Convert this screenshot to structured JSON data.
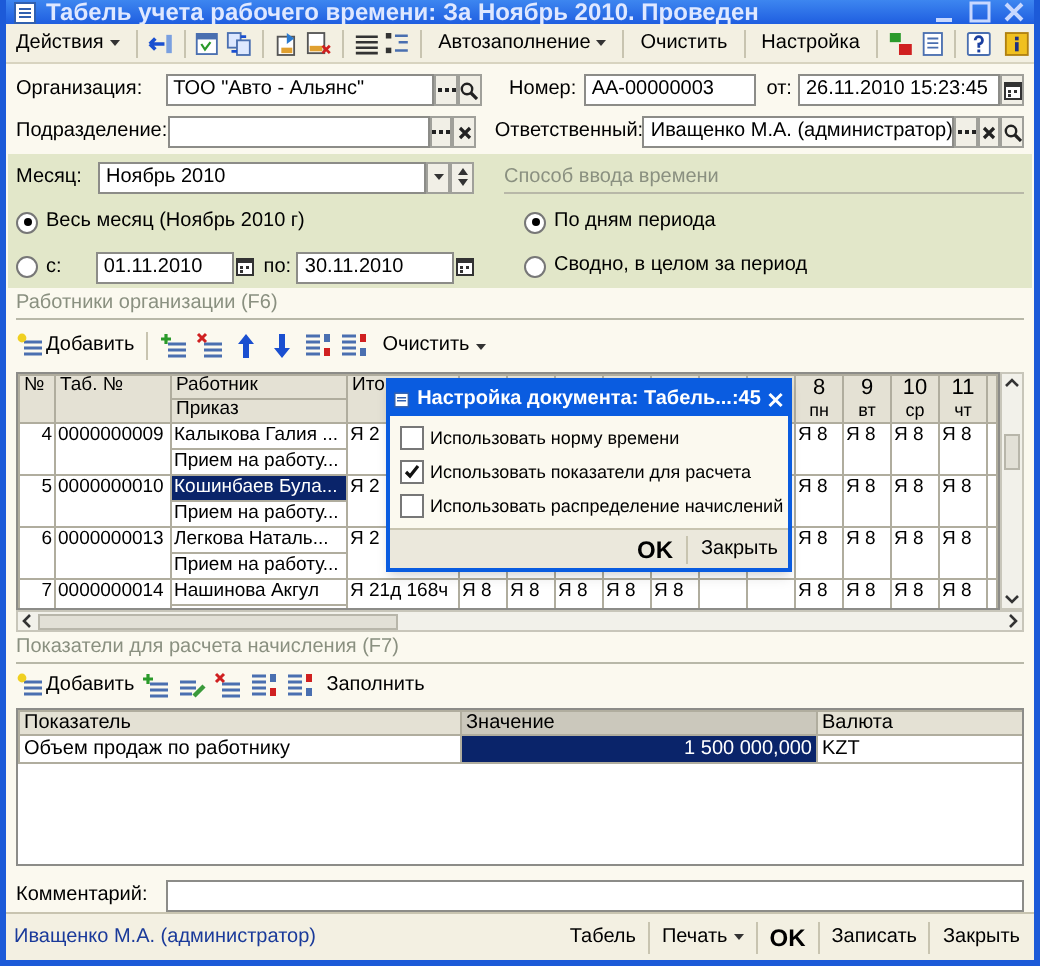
{
  "window": {
    "title": "Табель учета рабочего времени: За Ноябрь 2010. Проведен"
  },
  "toolbar": {
    "actions_menu": "Действия",
    "autofill_menu": "Автозаполнение",
    "clear": "Очистить",
    "settings": "Настройка"
  },
  "header": {
    "organization": {
      "label": "Организация:",
      "value": "ТОО \"Авто - Альянс\""
    },
    "number": {
      "label": "Номер:",
      "value": "АА-00000003"
    },
    "date": {
      "label": "от:",
      "value": "26.11.2010 15:23:45"
    },
    "subdivision": {
      "label": "Подразделение:"
    },
    "responsible": {
      "label": "Ответственный:",
      "value": "Иващенко М.А. (администратор)"
    }
  },
  "period": {
    "month_label": "Месяц:",
    "month": "Ноябрь 2010",
    "options": [
      {
        "label": "Весь месяц (Ноябрь 2010 г)",
        "selected": true
      },
      {
        "label": "с:",
        "selected": false
      }
    ],
    "from": "01.11.2010",
    "to_label": "по:",
    "to": "30.11.2010"
  },
  "time_input": {
    "title": "Способ ввода времени",
    "options": [
      {
        "label": "По дням периода",
        "selected": true
      },
      {
        "label": "Сводно, в целом за период",
        "selected": false
      }
    ]
  },
  "workers": {
    "title": "Работники организации (F6)",
    "add": "Добавить",
    "clear": "Очистить",
    "columns": [
      "№",
      "Таб. №",
      "Работник",
      "Ито"
    ],
    "sub_column": "Приказ",
    "day_columns": [
      {
        "day": "8",
        "weekday": "пн"
      },
      {
        "day": "9",
        "weekday": "вт"
      },
      {
        "day": "10",
        "weekday": "ср"
      },
      {
        "day": "11",
        "weekday": "чт"
      }
    ],
    "rows": [
      {
        "no": "4",
        "tab": "0000000009",
        "employee": "Калыкова Галия ...",
        "order": "Прием на работу...",
        "total": "Я 2",
        "selected": false,
        "days": [
          "Я 8",
          "Я 8",
          "Я 8",
          "Я 8"
        ]
      },
      {
        "no": "5",
        "tab": "0000000010",
        "employee": "Кошинбаев  Була...",
        "order": "Прием на работу...",
        "total": "Я 2",
        "selected": true,
        "days": [
          "Я 8",
          "Я 8",
          "Я 8",
          "Я 8"
        ]
      },
      {
        "no": "6",
        "tab": "0000000013",
        "employee": "Легкова Наталь...",
        "order": "Прием на работу...",
        "total": "Я 2",
        "selected": false,
        "days": [
          "Я 8",
          "Я 8",
          "Я 8",
          "Я 8"
        ]
      },
      {
        "no": "7",
        "tab": "0000000014",
        "employee": "Нашинова Акгул",
        "total": "Я 21д 168ч",
        "selected": false,
        "hidden_days": [
          "Я 8",
          "Я 8",
          "Я 8",
          "Я 8",
          "Я 8"
        ],
        "days": [
          "Я 8",
          "Я 8",
          "Я 8",
          "Я 8"
        ]
      }
    ]
  },
  "dialog": {
    "title": "Настройка документа: Табель...:45",
    "options": [
      {
        "label": "Использовать норму времени",
        "checked": false
      },
      {
        "label": "Использовать показатели для расчета",
        "checked": true
      },
      {
        "label": "Использовать распределение начислений",
        "checked": false
      }
    ],
    "ok": "OK",
    "close": "Закрыть"
  },
  "indicators": {
    "title": "Показатели для расчета начисления (F7)",
    "add": "Добавить",
    "fill": "Заполнить",
    "columns": [
      "Показатель",
      "Значение",
      "Валюта"
    ],
    "rows": [
      {
        "indicator": "Объем продаж по работнику",
        "value": "1 500 000,000",
        "currency": "KZT",
        "selected": true
      }
    ]
  },
  "comment": {
    "label": "Комментарий:"
  },
  "status_bar": {
    "user": "Иващенко М.А. (администратор)",
    "buttons": [
      {
        "label": "Табель",
        "kind": "plain"
      },
      {
        "label": "Печать",
        "kind": "menu"
      },
      {
        "label": "OK",
        "kind": "bold"
      },
      {
        "label": "Записать",
        "kind": "plain"
      },
      {
        "label": "Закрыть",
        "kind": "plain"
      }
    ]
  }
}
